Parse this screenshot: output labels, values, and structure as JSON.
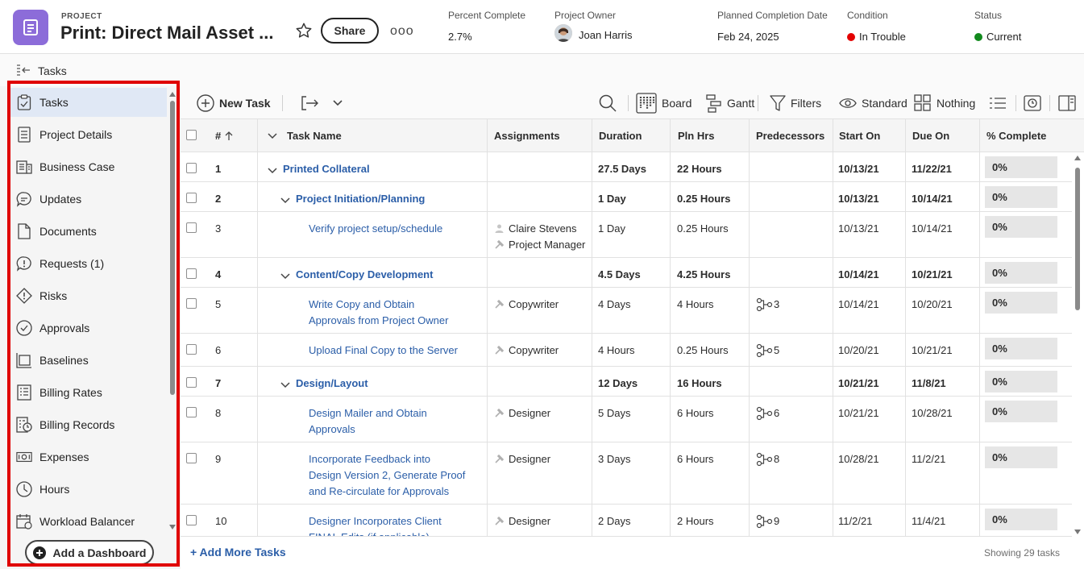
{
  "header": {
    "project_label": "PROJECT",
    "title": "Print: Direct Mail Asset ...",
    "share_label": "Share",
    "more_label": "ooo",
    "percent_complete": {
      "label": "Percent Complete",
      "value": "2.7%"
    },
    "owner": {
      "label": "Project Owner",
      "value": "Joan Harris"
    },
    "planned_completion": {
      "label": "Planned Completion Date",
      "value": "Feb 24, 2025"
    },
    "condition": {
      "label": "Condition",
      "value": "In Trouble",
      "color": "#e30000"
    },
    "status": {
      "label": "Status",
      "value": "Current",
      "color": "#128a1e"
    }
  },
  "subbar": {
    "title": "Tasks"
  },
  "sidebar": {
    "items": [
      {
        "label": "Tasks",
        "icon": "tasks-clipboard-icon"
      },
      {
        "label": "Project Details",
        "icon": "document-lines-icon"
      },
      {
        "label": "Business Case",
        "icon": "business-case-icon"
      },
      {
        "label": "Updates",
        "icon": "chat-bubble-icon"
      },
      {
        "label": "Documents",
        "icon": "file-icon"
      },
      {
        "label": "Requests (1)",
        "icon": "request-bubble-icon"
      },
      {
        "label": "Risks",
        "icon": "risk-diamond-icon"
      },
      {
        "label": "Approvals",
        "icon": "check-circle-icon"
      },
      {
        "label": "Baselines",
        "icon": "baseline-icon"
      },
      {
        "label": "Billing Rates",
        "icon": "billing-rates-icon"
      },
      {
        "label": "Billing Records",
        "icon": "billing-records-icon"
      },
      {
        "label": "Expenses",
        "icon": "money-icon"
      },
      {
        "label": "Hours",
        "icon": "clock-icon"
      },
      {
        "label": "Workload Balancer",
        "icon": "calendar-icon"
      }
    ],
    "add_dashboard": "Add a Dashboard"
  },
  "toolbar": {
    "new_task": "New Task",
    "board": "Board",
    "gantt": "Gantt",
    "filters": "Filters",
    "view": "Standard",
    "grouping": "Nothing"
  },
  "grid": {
    "columns": {
      "num": "#",
      "name": "Task Name",
      "assignments": "Assignments",
      "duration": "Duration",
      "pln_hrs": "Pln Hrs",
      "predecessors": "Predecessors",
      "start_on": "Start On",
      "due_on": "Due On",
      "pct": "% Complete"
    },
    "rows": [
      {
        "num": "1",
        "name": [
          "Printed Collateral"
        ],
        "assign": [],
        "duration": "27.5 Days",
        "pln": "22 Hours",
        "pred": "",
        "start": "10/13/21",
        "due": "11/22/21",
        "pct": "0%"
      },
      {
        "num": "2",
        "name": [
          "Project Initiation/Planning"
        ],
        "assign": [],
        "duration": "1 Day",
        "pln": "0.25 Hours",
        "pred": "",
        "start": "10/13/21",
        "due": "10/14/21",
        "pct": "0%"
      },
      {
        "num": "3",
        "name": [
          "Verify project setup/schedule"
        ],
        "assign": [
          "Claire Stevens",
          "Project Manager"
        ],
        "duration": "1 Day",
        "pln": "0.25 Hours",
        "pred": "",
        "start": "10/13/21",
        "due": "10/14/21",
        "pct": "0%"
      },
      {
        "num": "4",
        "name": [
          "Content/Copy Development"
        ],
        "assign": [],
        "duration": "4.5 Days",
        "pln": "4.25 Hours",
        "pred": "",
        "start": "10/14/21",
        "due": "10/21/21",
        "pct": "0%"
      },
      {
        "num": "5",
        "name": [
          "Write Copy and Obtain",
          "Approvals from Project Owner"
        ],
        "assign": [
          "Copywriter"
        ],
        "duration": "4 Days",
        "pln": "4 Hours",
        "pred": "3",
        "start": "10/14/21",
        "due": "10/20/21",
        "pct": "0%"
      },
      {
        "num": "6",
        "name": [
          "Upload Final Copy to the Server"
        ],
        "assign": [
          "Copywriter"
        ],
        "duration": "4 Hours",
        "pln": "0.25 Hours",
        "pred": "5",
        "start": "10/20/21",
        "due": "10/21/21",
        "pct": "0%"
      },
      {
        "num": "7",
        "name": [
          "Design/Layout"
        ],
        "assign": [],
        "duration": "12 Days",
        "pln": "16 Hours",
        "pred": "",
        "start": "10/21/21",
        "due": "11/8/21",
        "pct": "0%"
      },
      {
        "num": "8",
        "name": [
          "Design Mailer and Obtain",
          "Approvals"
        ],
        "assign": [
          "Designer"
        ],
        "duration": "5 Days",
        "pln": "6 Hours",
        "pred": "6",
        "start": "10/21/21",
        "due": "10/28/21",
        "pct": "0%"
      },
      {
        "num": "9",
        "name": [
          "Incorporate Feedback into",
          "Design Version 2, Generate Proof",
          "and Re-circulate for Approvals"
        ],
        "assign": [
          "Designer"
        ],
        "duration": "3 Days",
        "pln": "6 Hours",
        "pred": "8",
        "start": "10/28/21",
        "due": "11/2/21",
        "pct": "0%"
      },
      {
        "num": "10",
        "name": [
          "Designer Incorporates Client",
          "FINAL Edits (if applicable)"
        ],
        "assign": [
          "Designer"
        ],
        "duration": "2 Days",
        "pln": "2 Hours",
        "pred": "9",
        "start": "11/2/21",
        "due": "11/4/21",
        "pct": "0%"
      }
    ]
  },
  "footer": {
    "add_more": "+ Add More Tasks",
    "showing": "Showing 29 tasks"
  }
}
